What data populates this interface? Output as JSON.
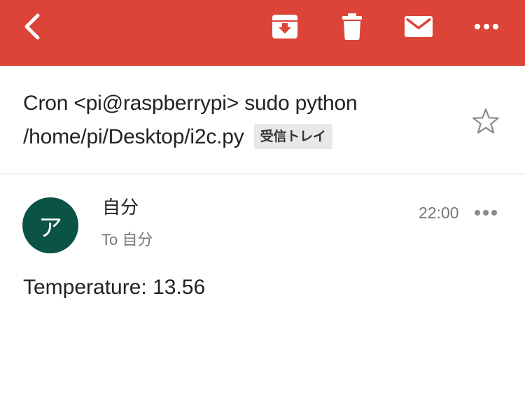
{
  "toolbar": {
    "bg_color": "#db4437",
    "icons": {
      "back": "chevron-left-icon",
      "archive": "archive-icon",
      "delete": "trash-icon",
      "mark_unread": "envelope-icon",
      "more": "more-horizontal-icon"
    }
  },
  "message": {
    "subject": "Cron <pi@raspberrypi> sudo python /home/pi/Desktop/i2c.py",
    "label": "受信トレイ",
    "starred": false,
    "sender": {
      "initial": "ア",
      "name": "自分",
      "avatar_color": "#0b5345"
    },
    "recipient": {
      "prefix": "To",
      "name": "自分"
    },
    "time": "22:00",
    "body": "Temperature: 13.56"
  }
}
